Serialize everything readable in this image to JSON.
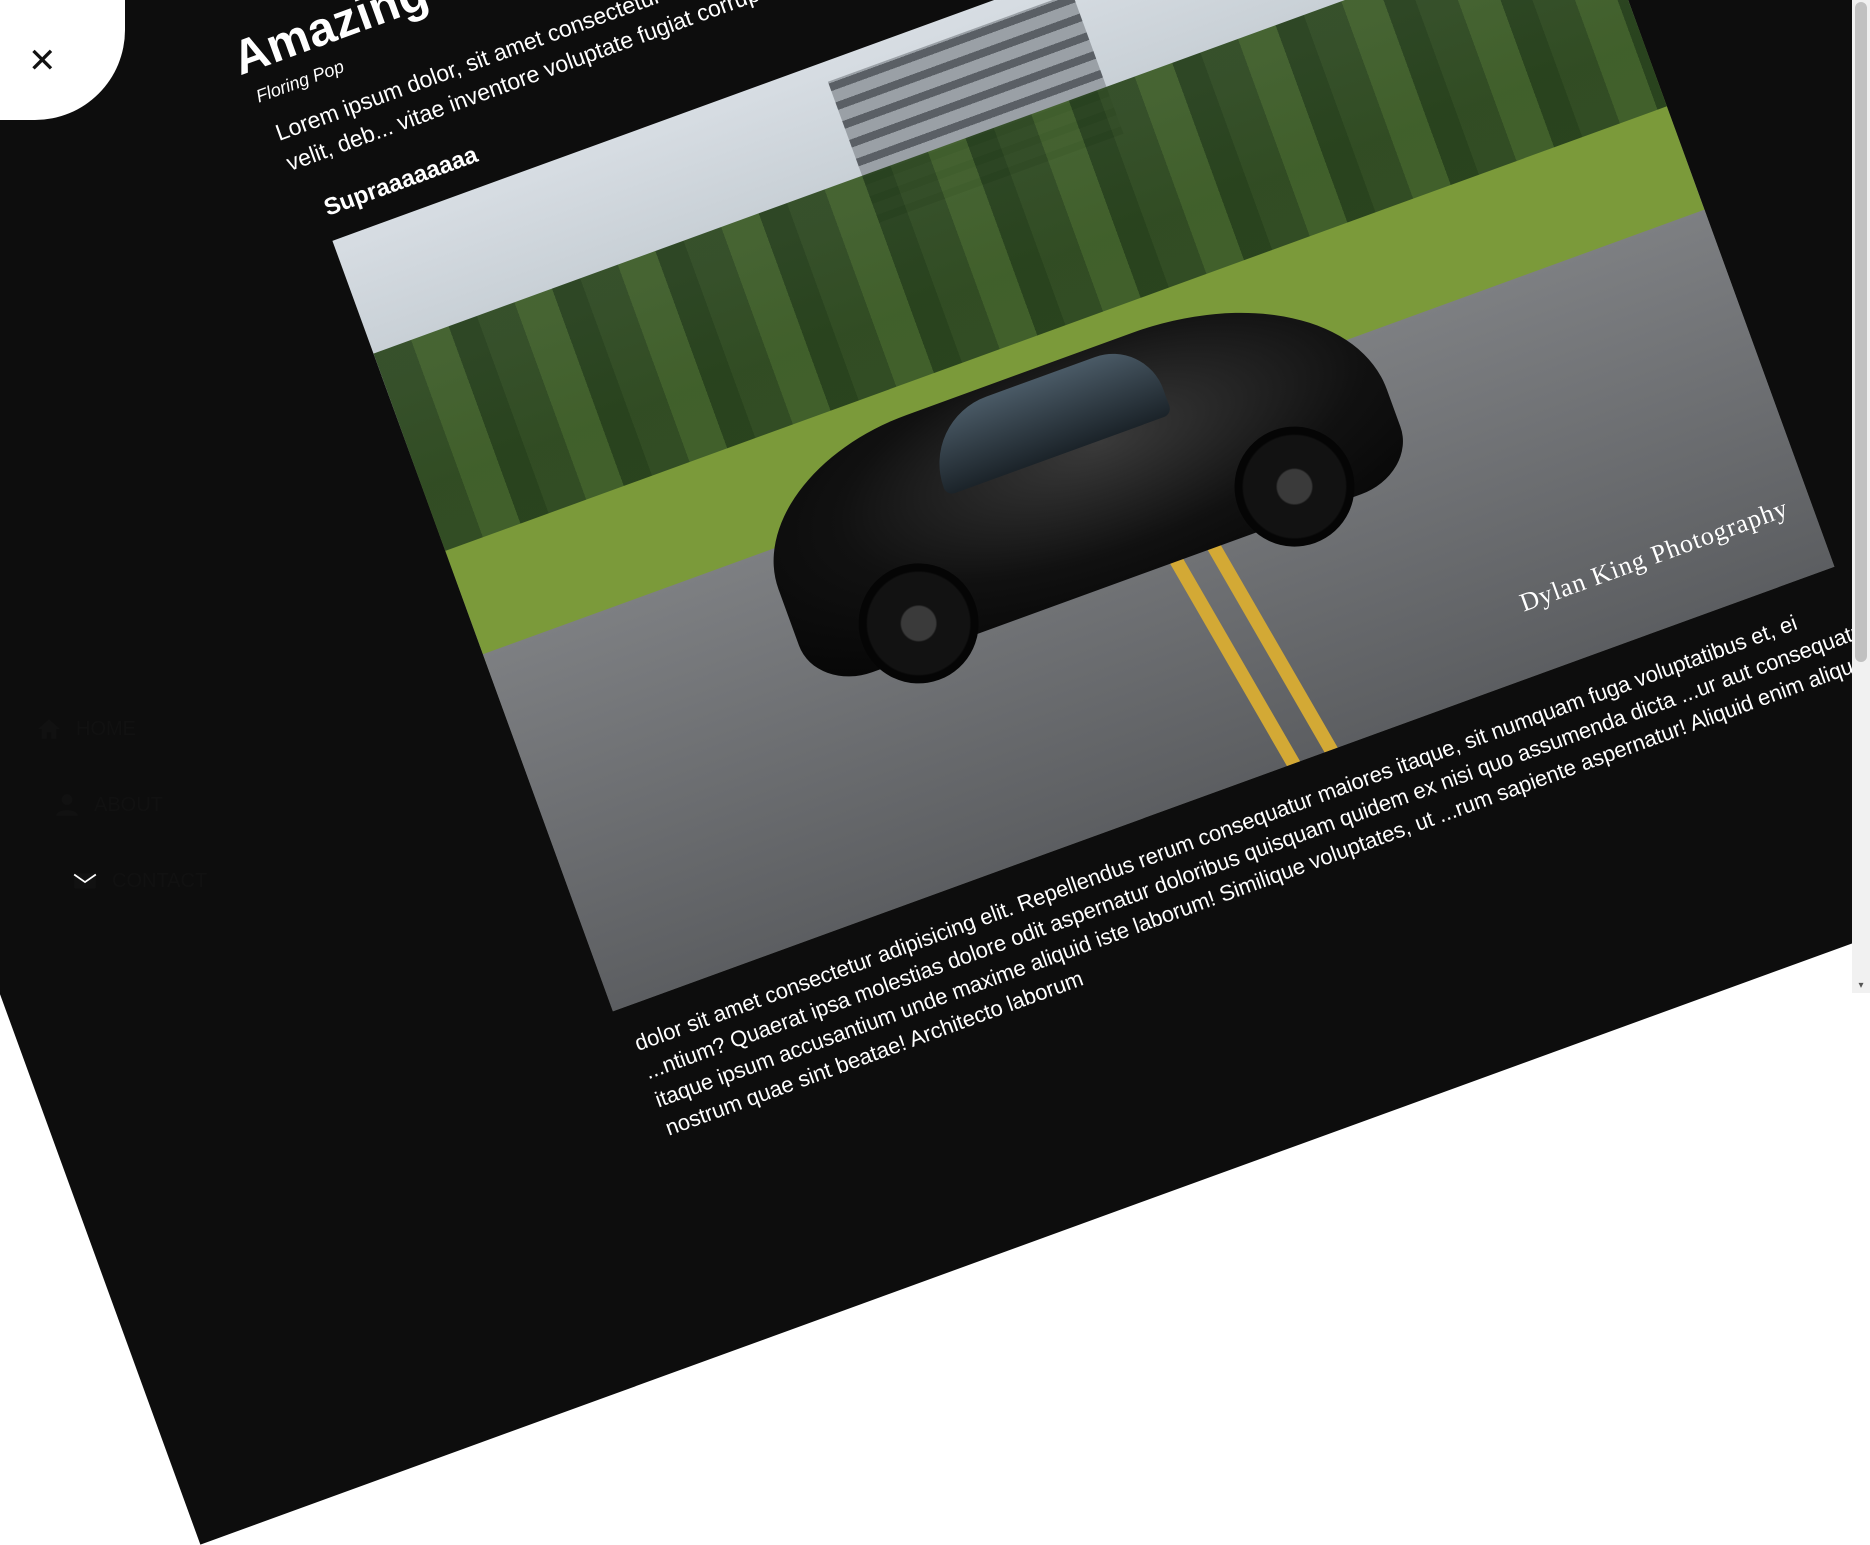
{
  "article": {
    "title": "Amazing",
    "author": "Floring Pop",
    "lede": "Lorem ipsum dolor, sit amet consectetur ... maiores porro, ipsa sapiente rerum quo, velit, deb... vitae inventore voluptate fugiat corrupti excepturi impedit.",
    "subhead": "Supraaaaaaaa",
    "image_watermark": "Dylan King Photography",
    "body": "dolor sit amet consectetur adipisicing elit. Repellendus rerum consequatur maiores itaque, sit numquam fuga voluptatibus et, ei ...ntium? Quaerat ipsa molestias dolore odit aspernatur doloribus quisquam quidem ex nisi quo assumenda dicta ...ur aut consequatur, itaque ipsum accusantium unde maxime aliquid iste laborum! Similique voluptates, ut ...rum sapiente aspernatur! Aliquid enim aliquam nostrum quae sint beatae! Architecto laborum"
  },
  "menu": {
    "close_icon": "close-icon",
    "items": [
      {
        "label": "HOME",
        "icon": "home-icon"
      },
      {
        "label": "ABOUT",
        "icon": "user-icon"
      },
      {
        "label": "CONTACT",
        "icon": "envelope-icon"
      }
    ]
  },
  "colors": {
    "page_background": "#0d0d0d",
    "menu_background": "#ffffff",
    "text_on_dark": "#ffffff",
    "text_on_light": "#111111"
  }
}
